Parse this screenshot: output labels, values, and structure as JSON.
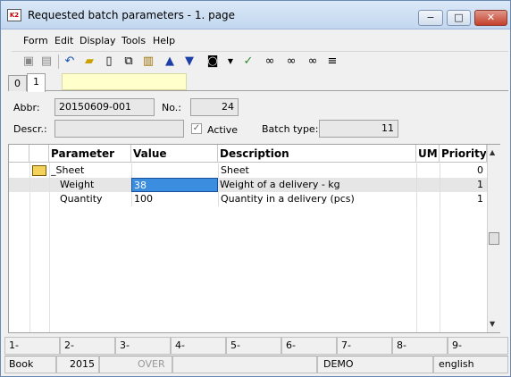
{
  "window": {
    "title": "Requested batch parameters - 1. page",
    "min_symbol": "−",
    "max_symbol": "□",
    "close_symbol": "✕"
  },
  "menu": [
    "Form",
    "Edit",
    "Display",
    "Tools",
    "Help"
  ],
  "toolbar": {
    "icons": [
      "save-icon",
      "save-as-icon",
      "undo-icon",
      "open-folder-icon",
      "new-document-icon",
      "copy-icon",
      "book-icon",
      "arrow-up-icon",
      "arrow-down-icon",
      "camera-icon",
      "dropdown-arrow-icon",
      "find-icon",
      "binoculars-icon",
      "binoculars-next-icon",
      "menu-icon"
    ]
  },
  "tabs": [
    {
      "label": "0",
      "active": false
    },
    {
      "label": "1",
      "active": true
    }
  ],
  "form": {
    "abbr_label": "Abbr:",
    "abbr_value": "20150609-001",
    "no_label": "No.:",
    "no_value": "24",
    "descr_label": "Descr.:",
    "descr_value": "",
    "active_label": "Active",
    "active_checked": true,
    "batch_type_label": "Batch type:",
    "batch_type_value": "11"
  },
  "grid": {
    "columns": [
      "Parameter",
      "Value",
      "Description",
      "UM",
      "Priority"
    ],
    "rows": [
      {
        "parameter": "_Sheet",
        "value": "",
        "description": "Sheet",
        "um": "",
        "priority": "0",
        "folder": true
      },
      {
        "parameter": "Weight",
        "value": "38",
        "description": "Weight of a delivery - kg",
        "um": "",
        "priority": "1",
        "folder": false,
        "selected": true
      },
      {
        "parameter": "Quantity",
        "value": "100",
        "description": "Quantity in a delivery (pcs)",
        "um": "",
        "priority": "1",
        "folder": false
      }
    ]
  },
  "fkeys": [
    "1-",
    "2-",
    "3-",
    "4-",
    "5-",
    "6-",
    "7-",
    "8-",
    "9-"
  ],
  "status": {
    "module": "Book",
    "year": "2015",
    "mode": "OVER",
    "database": "DEMO",
    "language": "english"
  }
}
